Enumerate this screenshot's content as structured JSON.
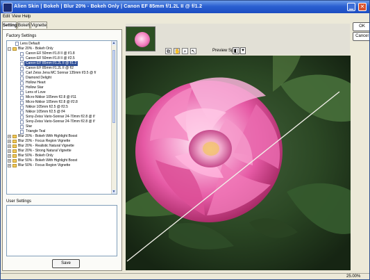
{
  "window": {
    "title": "Alien Skin | Bokeh | Blur 20% - Bokeh Only | Canon EF 85mm f/1.2L II @ f/1.2"
  },
  "menu": [
    "Edit",
    "View",
    "Help"
  ],
  "tabs": {
    "items": [
      "Settings",
      "Bokeh",
      "Vignette"
    ],
    "active": "Settings"
  },
  "left_panel": {
    "factory_settings_label": "Factory Settings",
    "user_settings_label": "User Settings",
    "save_label": "Save",
    "tree_items": [
      {
        "label": "Lens Default",
        "icon": "doc-icon"
      },
      {
        "label": "Blur 20% - Bokeh Only",
        "icon": "folder-icon",
        "expanded": true
      },
      {
        "label": "Canon EF 50mm f/1.8 II @ f/1.8",
        "icon": "doc-icon"
      },
      {
        "label": "Canon EF 50mm f/1.8 II @ f/2.5",
        "icon": "doc-icon"
      },
      {
        "label": "Canon EF 85mm f/1.2L II @ f/1.2",
        "icon": "doc-icon",
        "selected": true
      },
      {
        "label": "Canon EF 85mm f/1.2L II @ f/2",
        "icon": "doc-icon"
      },
      {
        "label": "Carl Zeiss Jena MC Sonnar 135mm f/3.5 @ f/",
        "icon": "doc-icon"
      },
      {
        "label": "Diamond Delight",
        "icon": "doc-icon"
      },
      {
        "label": "Hollow Heart",
        "icon": "doc-icon"
      },
      {
        "label": "Hollow Star",
        "icon": "doc-icon"
      },
      {
        "label": "Lens of Love",
        "icon": "doc-icon"
      },
      {
        "label": "Micro-Nikkor 105mm f/2.8 @ f/11",
        "icon": "doc-icon"
      },
      {
        "label": "Micro-Nikkor 105mm f/2.8 @ f/2.8",
        "icon": "doc-icon"
      },
      {
        "label": "Nikkor 105mm f/2.5 @ f/2.5",
        "icon": "doc-icon"
      },
      {
        "label": "Nikkor 105mm f/2.5 @ f/4",
        "icon": "doc-icon"
      },
      {
        "label": "Sony-Zeiss Vario-Sonnar 24-70mm f/2.8 @ f/",
        "icon": "doc-icon"
      },
      {
        "label": "Sony-Zeiss Vario-Sonnar 24-70mm f/2.8 @ f/",
        "icon": "doc-icon"
      },
      {
        "label": "Star",
        "icon": "doc-icon"
      },
      {
        "label": "Triangle Teal",
        "icon": "doc-icon"
      },
      {
        "label": "Blur 20% - Bokeh With Highlight Boost",
        "icon": "folder-icon",
        "expanded": false
      },
      {
        "label": "Blur 20% - Focus Region Vignette",
        "icon": "folder-icon",
        "expanded": false
      },
      {
        "label": "Blur 20% - Realistic Natural Vignette",
        "icon": "folder-icon",
        "expanded": false
      },
      {
        "label": "Blur 20% - Strong Natural Vignette",
        "icon": "folder-icon",
        "expanded": false
      },
      {
        "label": "Blur 50% - Bokeh Only",
        "icon": "folder-icon",
        "expanded": false
      },
      {
        "label": "Blur 50% - Bokeh With Highlight Boost",
        "icon": "folder-icon",
        "expanded": false
      },
      {
        "label": "Blur 50% - Focus Region Vignette",
        "icon": "folder-icon",
        "expanded": false
      }
    ]
  },
  "toolbar": {
    "preview_split_label": "Preview Split",
    "tools": [
      "crop-icon",
      "hand-icon",
      "zoom-icon",
      "pointer-icon"
    ]
  },
  "buttons": {
    "ok": "OK",
    "cancel": "Cancel"
  },
  "status": {
    "zoom": "25.00%"
  }
}
